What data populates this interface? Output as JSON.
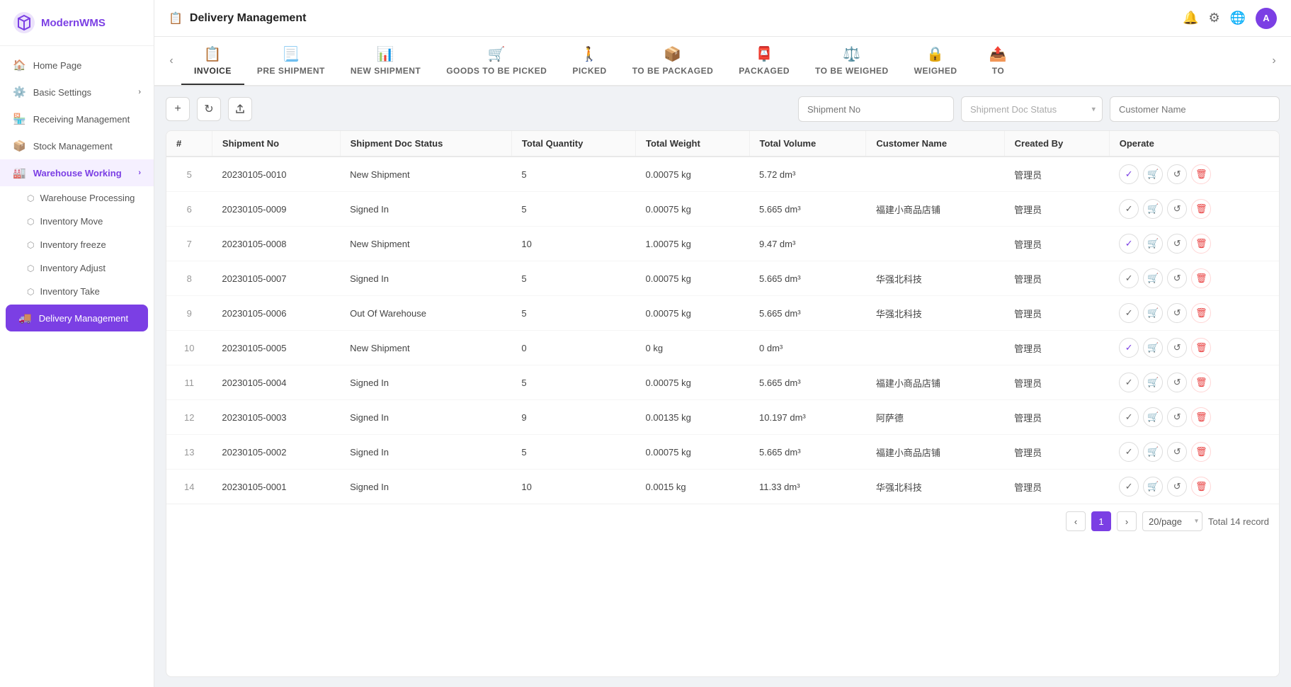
{
  "app": {
    "name": "ModernWMS"
  },
  "sidebar": {
    "nav_items": [
      {
        "id": "home",
        "label": "Home Page",
        "icon": "🏠",
        "has_sub": false,
        "active": false
      },
      {
        "id": "basic-settings",
        "label": "Basic Settings",
        "icon": "⚙️",
        "has_sub": true,
        "active": false
      },
      {
        "id": "receiving",
        "label": "Receiving Management",
        "icon": "🏪",
        "has_sub": false,
        "active": false
      },
      {
        "id": "stock",
        "label": "Stock Management",
        "icon": "📦",
        "has_sub": false,
        "active": false
      },
      {
        "id": "warehouse-working",
        "label": "Warehouse Working",
        "icon": "🏭",
        "has_sub": true,
        "active": true,
        "expanded": true
      },
      {
        "id": "delivery",
        "label": "Delivery Management",
        "icon": "🚚",
        "has_sub": false,
        "active": true,
        "is_active_leaf": true
      }
    ],
    "sub_items": [
      {
        "id": "warehouse-processing",
        "label": "Warehouse Processing",
        "icon": "⬡",
        "parent": "warehouse-working"
      },
      {
        "id": "inventory-move",
        "label": "Inventory Move",
        "icon": "⬡",
        "parent": "warehouse-working"
      },
      {
        "id": "inventory-freeze",
        "label": "Inventory freeze",
        "icon": "⬡",
        "parent": "warehouse-working"
      },
      {
        "id": "inventory-adjust",
        "label": "Inventory Adjust",
        "icon": "⬡",
        "parent": "warehouse-working"
      },
      {
        "id": "inventory-take",
        "label": "Inventory Take",
        "icon": "⬡",
        "parent": "warehouse-working"
      }
    ]
  },
  "topbar": {
    "title": "Delivery Management",
    "icon": "📋"
  },
  "tabs": [
    {
      "id": "invoice",
      "label": "INVOICE",
      "icon": "📋",
      "active": true
    },
    {
      "id": "pre-shipment",
      "label": "PRE SHIPMENT",
      "icon": "📃",
      "active": false
    },
    {
      "id": "new-shipment",
      "label": "NEW SHIPMENT",
      "icon": "📊",
      "active": false
    },
    {
      "id": "goods-to-be-picked",
      "label": "GOODS TO BE PICKED",
      "icon": "🛒",
      "active": false
    },
    {
      "id": "picked",
      "label": "PICKED",
      "icon": "🚶",
      "active": false
    },
    {
      "id": "to-be-packaged",
      "label": "TO BE PACKAGED",
      "icon": "📦",
      "active": false
    },
    {
      "id": "packaged",
      "label": "PACKAGED",
      "icon": "📮",
      "active": false
    },
    {
      "id": "to-be-weighed",
      "label": "TO BE WEIGHED",
      "icon": "⚖️",
      "active": false
    },
    {
      "id": "weighed",
      "label": "WEIGHED",
      "icon": "🔒",
      "active": false
    },
    {
      "id": "to",
      "label": "TO",
      "icon": "📤",
      "active": false
    }
  ],
  "toolbar": {
    "add_label": "+",
    "refresh_label": "↻",
    "export_label": "⬆",
    "shipment_no_placeholder": "Shipment No",
    "doc_status_placeholder": "Shipment Doc Status",
    "customer_name_placeholder": "Customer Name"
  },
  "table": {
    "columns": [
      "#",
      "Shipment No",
      "Shipment Doc Status",
      "Total Quantity",
      "Total Weight",
      "Total Volume",
      "Customer Name",
      "Created By",
      "Operate"
    ],
    "rows": [
      {
        "num": 5,
        "shipment_no": "20230105-0010",
        "doc_status": "New Shipment",
        "total_qty": 5,
        "total_weight": "0.00075 kg",
        "total_volume": "5.72 dm³",
        "customer_name": "",
        "created_by": "管理员"
      },
      {
        "num": 6,
        "shipment_no": "20230105-0009",
        "doc_status": "Signed In",
        "total_qty": 5,
        "total_weight": "0.00075 kg",
        "total_volume": "5.665 dm³",
        "customer_name": "福建小商品店铺",
        "created_by": "管理员"
      },
      {
        "num": 7,
        "shipment_no": "20230105-0008",
        "doc_status": "New Shipment",
        "total_qty": 10,
        "total_weight": "1.00075 kg",
        "total_volume": "9.47 dm³",
        "customer_name": "",
        "created_by": "管理员"
      },
      {
        "num": 8,
        "shipment_no": "20230105-0007",
        "doc_status": "Signed In",
        "total_qty": 5,
        "total_weight": "0.00075 kg",
        "total_volume": "5.665 dm³",
        "customer_name": "华强北科技",
        "created_by": "管理员"
      },
      {
        "num": 9,
        "shipment_no": "20230105-0006",
        "doc_status": "Out Of Warehouse",
        "total_qty": 5,
        "total_weight": "0.00075 kg",
        "total_volume": "5.665 dm³",
        "customer_name": "华强北科技",
        "created_by": "管理员"
      },
      {
        "num": 10,
        "shipment_no": "20230105-0005",
        "doc_status": "New Shipment",
        "total_qty": 0,
        "total_weight": "0 kg",
        "total_volume": "0 dm³",
        "customer_name": "",
        "created_by": "管理员"
      },
      {
        "num": 11,
        "shipment_no": "20230105-0004",
        "doc_status": "Signed In",
        "total_qty": 5,
        "total_weight": "0.00075 kg",
        "total_volume": "5.665 dm³",
        "customer_name": "福建小商品店铺",
        "created_by": "管理员"
      },
      {
        "num": 12,
        "shipment_no": "20230105-0003",
        "doc_status": "Signed In",
        "total_qty": 9,
        "total_weight": "0.00135 kg",
        "total_volume": "10.197 dm³",
        "customer_name": "阿萨德",
        "created_by": "管理员"
      },
      {
        "num": 13,
        "shipment_no": "20230105-0002",
        "doc_status": "Signed In",
        "total_qty": 5,
        "total_weight": "0.00075 kg",
        "total_volume": "5.665 dm³",
        "customer_name": "福建小商品店铺",
        "created_by": "管理员"
      },
      {
        "num": 14,
        "shipment_no": "20230105-0001",
        "doc_status": "Signed In",
        "total_qty": 10,
        "total_weight": "0.0015 kg",
        "total_volume": "11.33 dm³",
        "customer_name": "华强北科技",
        "created_by": "管理员"
      }
    ]
  },
  "pagination": {
    "current_page": 1,
    "per_page": "20/page",
    "total_text": "Total 14 record"
  }
}
